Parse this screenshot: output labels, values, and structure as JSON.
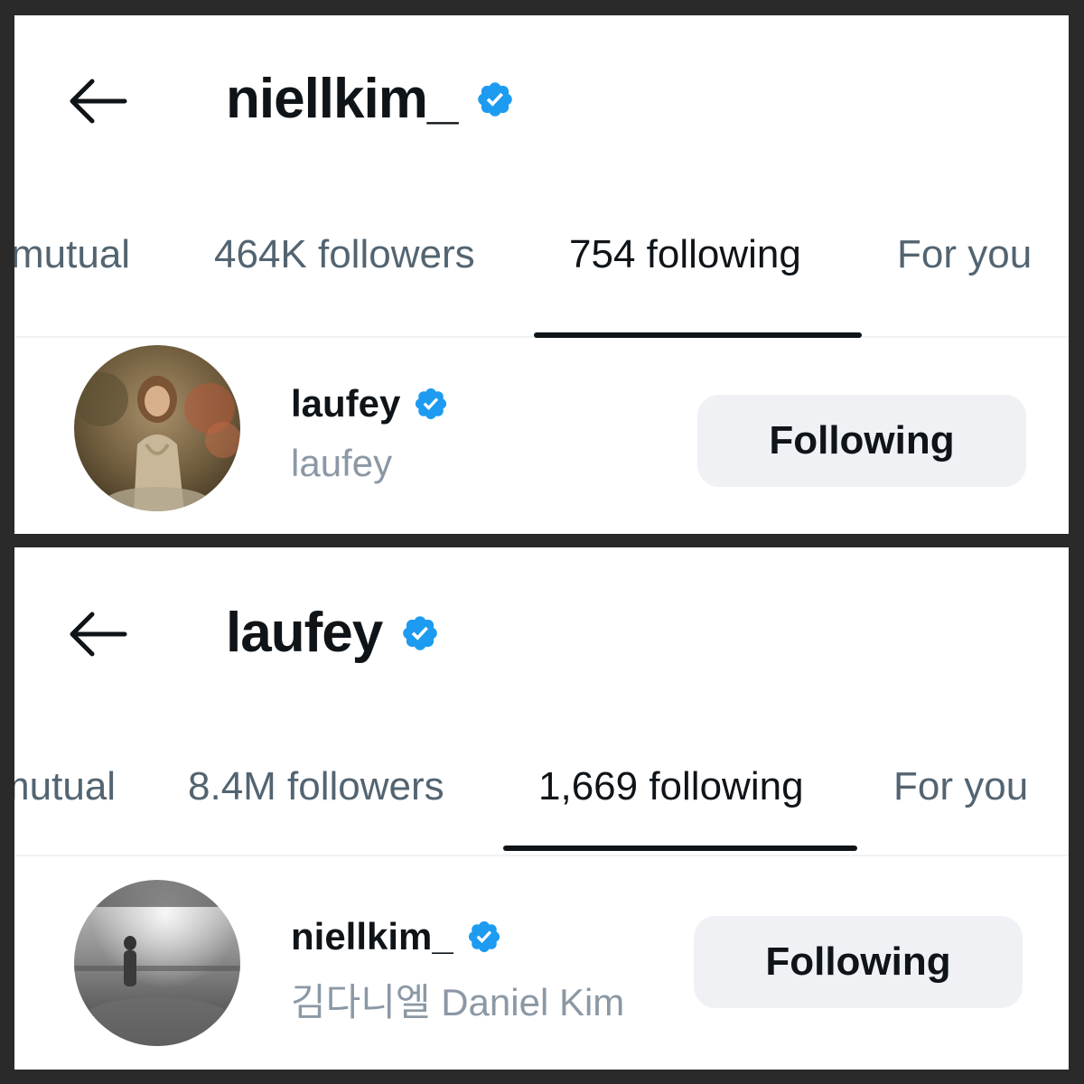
{
  "colors": {
    "verified_badge": "#1d9bf0",
    "tab_active": "#0f1419",
    "tab_inactive": "#536471",
    "button_bg": "#eff1f5"
  },
  "panels": [
    {
      "back_icon": "arrow-left-icon",
      "title": "niellkim_",
      "verified": true,
      "tabs": [
        {
          "label": "mutual",
          "active": false
        },
        {
          "label": "464K followers",
          "active": false
        },
        {
          "label": "754 following",
          "active": true
        },
        {
          "label": "For you",
          "active": false
        }
      ],
      "user": {
        "name": "laufey",
        "handle": "laufey",
        "verified": true,
        "avatar": "laufey-avatar",
        "button_label": "Following"
      }
    },
    {
      "back_icon": "arrow-left-icon",
      "title": "laufey",
      "verified": true,
      "tabs": [
        {
          "label": "mutual",
          "active": false
        },
        {
          "label": "8.4M followers",
          "active": false
        },
        {
          "label": "1,669 following",
          "active": true
        },
        {
          "label": "For you",
          "active": false
        }
      ],
      "user": {
        "name": "niellkim_",
        "handle": "김다니엘 Daniel Kim",
        "verified": true,
        "avatar": "niellkim-avatar",
        "button_label": "Following"
      }
    }
  ]
}
